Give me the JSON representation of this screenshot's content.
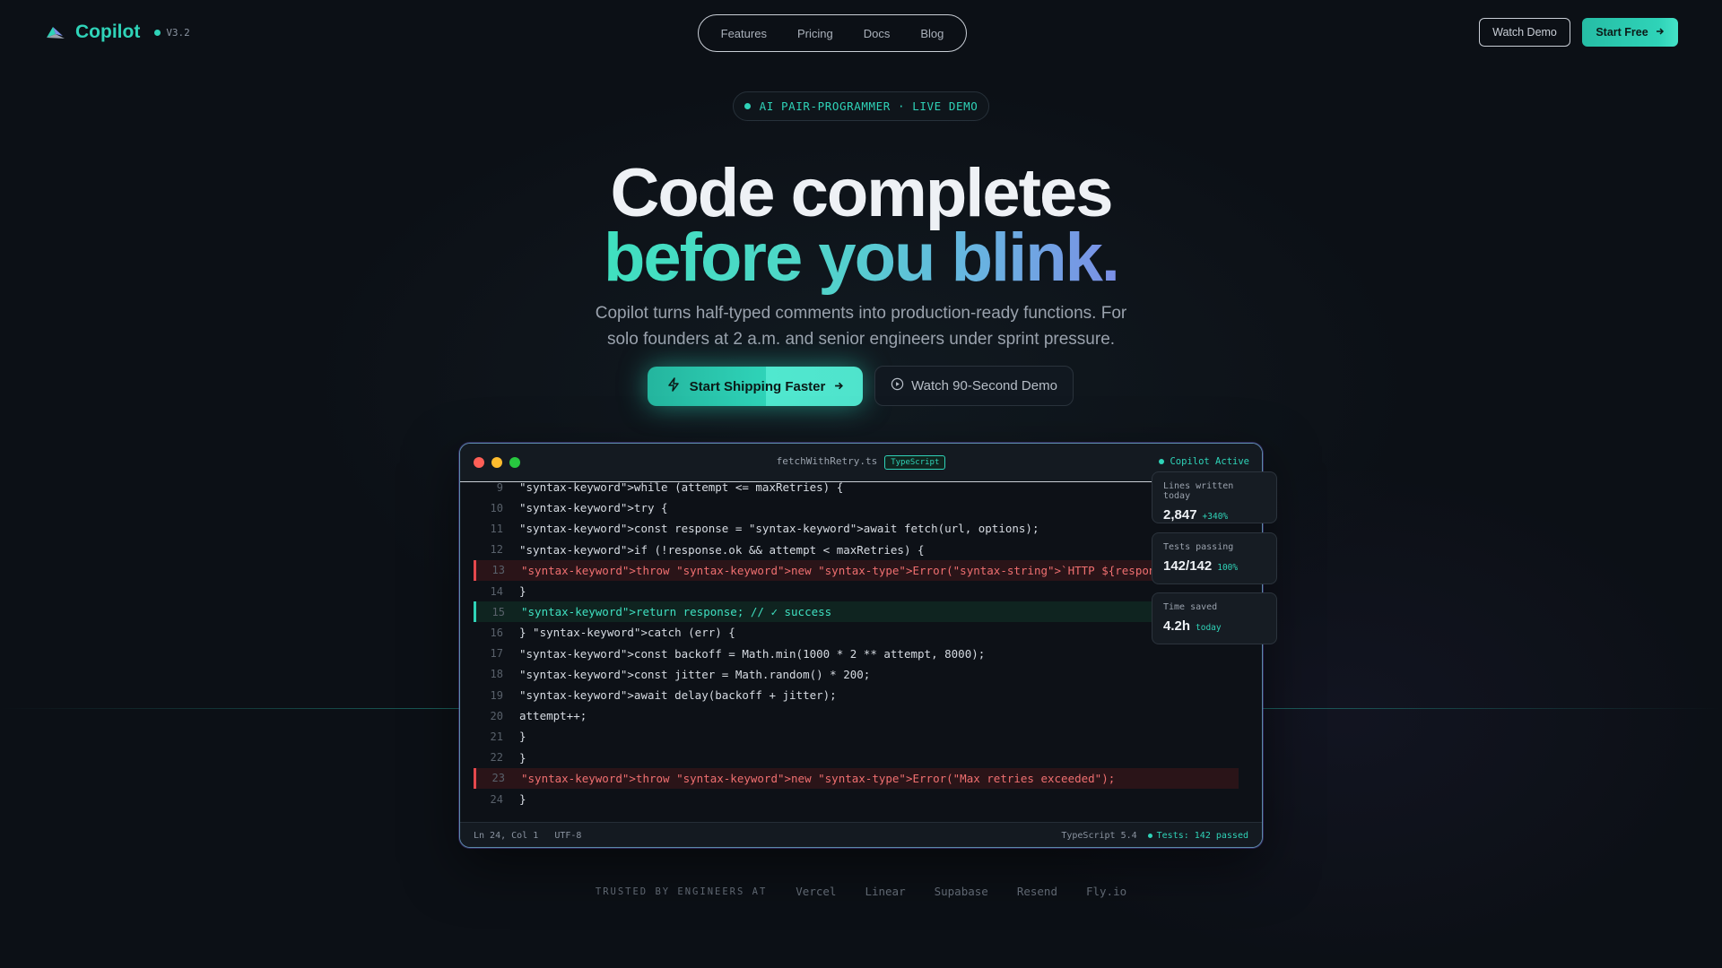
{
  "nav": {
    "brand": "Copilot",
    "version": "V3.2",
    "links": [
      "Features",
      "Pricing",
      "Docs",
      "Blog"
    ],
    "watch_demo": "Watch Demo",
    "start_free": "Start Free"
  },
  "hero": {
    "badge": "AI PAIR-PROGRAMMER · LIVE DEMO",
    "title_line1": "Code completes",
    "title_line2": "before you blink.",
    "subtitle": "Copilot turns half-typed comments into production-ready functions. For solo founders at 2 a.m. and senior engineers under sprint pressure.",
    "cta_primary": "Start Shipping Faster",
    "cta_secondary": "Watch 90-Second Demo"
  },
  "editor": {
    "filename": "fetchWithRetry.ts",
    "language_badge": "TypeScript",
    "status": "Copilot Active",
    "lines": [
      {
        "n": "9",
        "text": "\"syntax-keyword\">while (attempt <= maxRetries) {",
        "state": ""
      },
      {
        "n": "10",
        "text": "\"syntax-keyword\">try {",
        "state": ""
      },
      {
        "n": "11",
        "text": "\"syntax-keyword\">const response = \"syntax-keyword\">await fetch(url, options);",
        "state": ""
      },
      {
        "n": "12",
        "text": "\"syntax-keyword\">if (!response.ok && attempt < maxRetries) {",
        "state": ""
      },
      {
        "n": "13",
        "text": "\"syntax-keyword\">throw \"syntax-keyword\">new \"syntax-type\">Error(\"syntax-string\">`HTTP ${response.s",
        "state": "err"
      },
      {
        "n": "14",
        "text": "}",
        "state": ""
      },
      {
        "n": "15",
        "text": "\"syntax-keyword\">return response; // ✓ success",
        "state": "ok"
      },
      {
        "n": "16",
        "text": "} \"syntax-keyword\">catch (err) {",
        "state": ""
      },
      {
        "n": "17",
        "text": "\"syntax-keyword\">const backoff = Math.min(1000 * 2 ** attempt, 8000);",
        "state": ""
      },
      {
        "n": "18",
        "text": "\"syntax-keyword\">const jitter = Math.random() * 200;",
        "state": ""
      },
      {
        "n": "19",
        "text": "\"syntax-keyword\">await delay(backoff + jitter);",
        "state": ""
      },
      {
        "n": "20",
        "text": "attempt++;",
        "state": ""
      },
      {
        "n": "21",
        "text": "}",
        "state": ""
      },
      {
        "n": "22",
        "text": "}",
        "state": ""
      },
      {
        "n": "23",
        "text": "\"syntax-keyword\">throw \"syntax-keyword\">new \"syntax-type\">Error(\"Max retries exceeded\");",
        "state": "err"
      },
      {
        "n": "24",
        "text": "}",
        "state": ""
      }
    ],
    "statusbar": {
      "cursor": "Ln 24, Col 1",
      "encoding": "UTF-8",
      "language": "TypeScript 5.4",
      "tests": "Tests: 142 passed"
    }
  },
  "stats": [
    {
      "label": "Lines written today",
      "value": "2,847",
      "delta": "+340%"
    },
    {
      "label": "Tests passing",
      "value": "142/142",
      "delta": "100%"
    },
    {
      "label": "Time saved",
      "value": "4.2h",
      "delta": "today"
    }
  ],
  "trusted": {
    "label": "TRUSTED BY ENGINEERS AT",
    "companies": [
      "Vercel",
      "Linear",
      "Supabase",
      "Resend",
      "Fly.io"
    ]
  },
  "colors": {
    "accent": "#2fd3b8",
    "error": "#e5484d",
    "background": "#0c1016"
  }
}
